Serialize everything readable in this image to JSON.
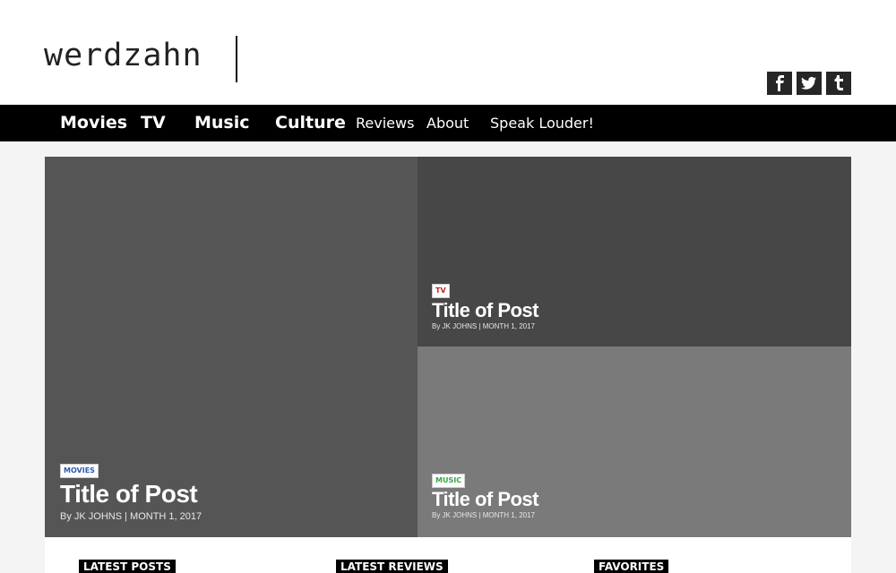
{
  "site": {
    "logo": "werdzahn"
  },
  "social": {
    "icons": [
      {
        "name": "facebook-icon",
        "glyph": "f"
      },
      {
        "name": "twitter-icon",
        "glyph": "•"
      },
      {
        "name": "tumblr-icon",
        "glyph": "t"
      }
    ]
  },
  "nav": {
    "items": [
      "Movies",
      "TV",
      "Music",
      "Culture",
      "Reviews",
      "About",
      "Speak Louder!"
    ]
  },
  "featured": {
    "main": {
      "tag": "MOVIES",
      "tag_color": "#2a5db0",
      "title": "Title of Post",
      "byline": "By JK JOHNS | MONTH 1, 2017"
    },
    "top_right": {
      "tag": "TV",
      "tag_color": "#c0222a",
      "title": "Title of Post",
      "byline": "By JK JOHNS | MONTH 1, 2017"
    },
    "bottom_right": {
      "tag": "MUSIC",
      "tag_color": "#3aa640",
      "title": "Title of Post",
      "byline": "By JK JOHNS | MONTH 1, 2017"
    }
  },
  "sections": {
    "latest_posts": "LATEST POSTS",
    "latest_reviews": "LATEST REVIEWS",
    "favorites": "FAVORITES"
  }
}
